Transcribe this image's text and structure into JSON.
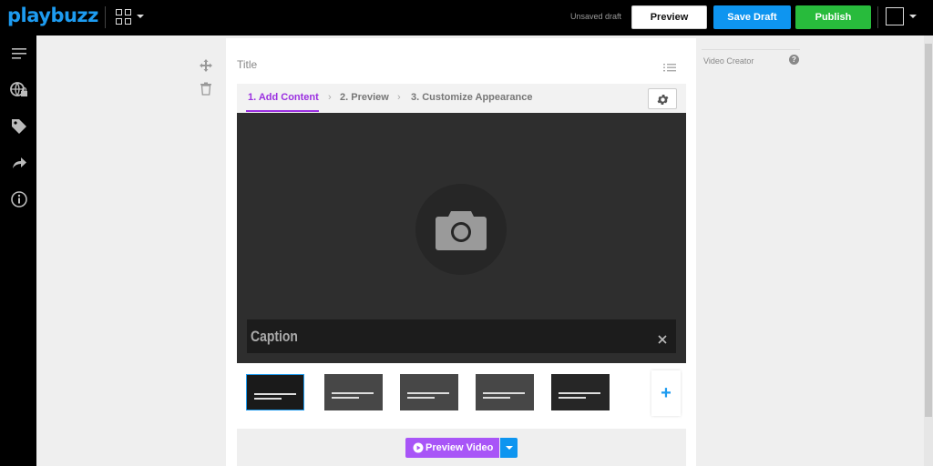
{
  "app": {
    "logo": "playbuzz"
  },
  "toolbar": {
    "draft_status": "Unsaved draft",
    "preview_label": "Preview",
    "save_draft_label": "Save Draft",
    "publish_label": "Publish"
  },
  "sidebar": {
    "icons": [
      "menu-icon",
      "globe-lock-icon",
      "tag-icon",
      "share-icon",
      "info-icon"
    ]
  },
  "editor": {
    "title_placeholder": "Title",
    "steps": [
      {
        "label": "1. Add Content",
        "active": true
      },
      {
        "label": "2. Preview",
        "active": false
      },
      {
        "label": "3. Customize Appearance",
        "active": false
      }
    ],
    "step_separator": "›",
    "caption_placeholder": "Caption",
    "close_glyph": "×",
    "slides": [
      {
        "selected": true
      },
      {
        "selected": false
      },
      {
        "selected": false
      },
      {
        "selected": false
      },
      {
        "selected": false
      }
    ],
    "add_slide_glyph": "+",
    "preview_video_label": "Preview Video"
  },
  "right_panel": {
    "label": "Video Creator",
    "help_glyph": "?"
  },
  "colors": {
    "accent_blue": "#0e95f0",
    "accent_green": "#28bb3c",
    "accent_purple": "#9b30e0",
    "preview_video_purple": "#a855f7",
    "media_bg": "#2e2e2e"
  }
}
